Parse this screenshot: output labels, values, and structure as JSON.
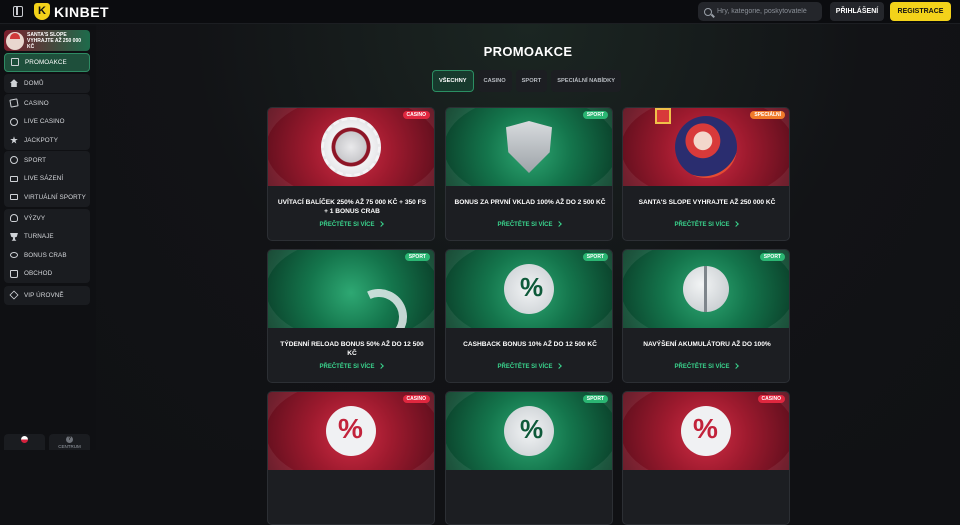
{
  "header": {
    "brand": "KINBET",
    "search_placeholder": "Hry, kategorie, poskytovatelé",
    "login_label": "PŘIHLÁŠENÍ",
    "register_label": "REGISTRACE",
    "accent_color": "#f3d21a"
  },
  "sidebar": {
    "promo_card_text": "SANTA'S SLOPE VYHRAJTE AŽ 250 000 KČ",
    "groups": [
      {
        "items": [
          {
            "label": "PROMOAKCE",
            "icon": "gift-icon",
            "active": true
          }
        ]
      },
      {
        "items": [
          {
            "label": "DOMŮ",
            "icon": "home-icon"
          }
        ]
      },
      {
        "items": [
          {
            "label": "CASINO",
            "icon": "cards-icon"
          },
          {
            "label": "LIVE CASINO",
            "icon": "roulette-icon"
          },
          {
            "label": "JACKPOTY",
            "icon": "star-icon"
          }
        ]
      },
      {
        "items": [
          {
            "label": "SPORT",
            "icon": "ball-icon"
          },
          {
            "label": "LIVE SÁZENÍ",
            "icon": "live-bet-icon"
          },
          {
            "label": "VIRTUÁLNÍ SPORTY",
            "icon": "virtual-sport-icon"
          }
        ]
      },
      {
        "items": [
          {
            "label": "VÝZVY",
            "icon": "challenge-icon"
          },
          {
            "label": "TURNAJE",
            "icon": "trophy-icon"
          },
          {
            "label": "BONUS CRAB",
            "icon": "crab-icon"
          },
          {
            "label": "OBCHOD",
            "icon": "shop-icon"
          }
        ]
      },
      {
        "items": [
          {
            "label": "VIP ÚROVNĚ",
            "icon": "diamond-icon"
          }
        ]
      }
    ],
    "help_label": "CENTRUM"
  },
  "main": {
    "title": "PROMOAKCE",
    "tabs": [
      {
        "label": "VŠECHNY",
        "active": true
      },
      {
        "label": "CASINO"
      },
      {
        "label": "SPORT"
      },
      {
        "label": "SPECIÁLNÍ NABÍDKY"
      }
    ],
    "cards": [
      {
        "badge": "CASINO",
        "badge_type": "casino",
        "theme": "red",
        "art": "chip",
        "title": "UVÍTACÍ BALÍČEK 250% AŽ 75 000 KČ + 350 FS + 1 BONUS CRAB",
        "link": "PŘEČTĚTE SI VÍCE"
      },
      {
        "badge": "SPORT",
        "badge_type": "sport",
        "theme": "green",
        "art": "shield",
        "title": "BONUS ZA PRVNÍ VKLAD 100% AŽ DO 2 500 KČ",
        "link": "PŘEČTĚTE SI VÍCE"
      },
      {
        "badge": "SPECIÁLNÍ",
        "badge_type": "special",
        "theme": "red",
        "art": "santa",
        "title": "SANTA'S SLOPE VYHRAJTE AŽ 250 000 KČ",
        "link": "PŘEČTĚTE SI VÍCE"
      },
      {
        "badge": "SPORT",
        "badge_type": "sport",
        "theme": "green",
        "art": "balls",
        "title": "TÝDENNÍ RELOAD BONUS 50% AŽ DO 12 500 KČ",
        "link": "PŘEČTĚTE SI VÍCE"
      },
      {
        "badge": "SPORT",
        "badge_type": "sport",
        "theme": "green",
        "art": "soccer",
        "title": "CASHBACK BONUS 10% AŽ DO 12 500 KČ",
        "link": "PŘEČTĚTE SI VÍCE"
      },
      {
        "badge": "SPORT",
        "badge_type": "sport",
        "theme": "green",
        "art": "basket",
        "title": "NAVÝŠENÍ AKUMULÁTORU AŽ DO 100%",
        "link": "PŘEČTĚTE SI VÍCE"
      },
      {
        "badge": "CASINO",
        "badge_type": "casino",
        "theme": "red",
        "art": "percent",
        "title": "",
        "link": ""
      },
      {
        "badge": "SPORT",
        "badge_type": "sport",
        "theme": "green",
        "art": "soccer",
        "title": "",
        "link": ""
      },
      {
        "badge": "CASINO",
        "badge_type": "casino",
        "theme": "red",
        "art": "percent",
        "title": "",
        "link": ""
      }
    ]
  }
}
